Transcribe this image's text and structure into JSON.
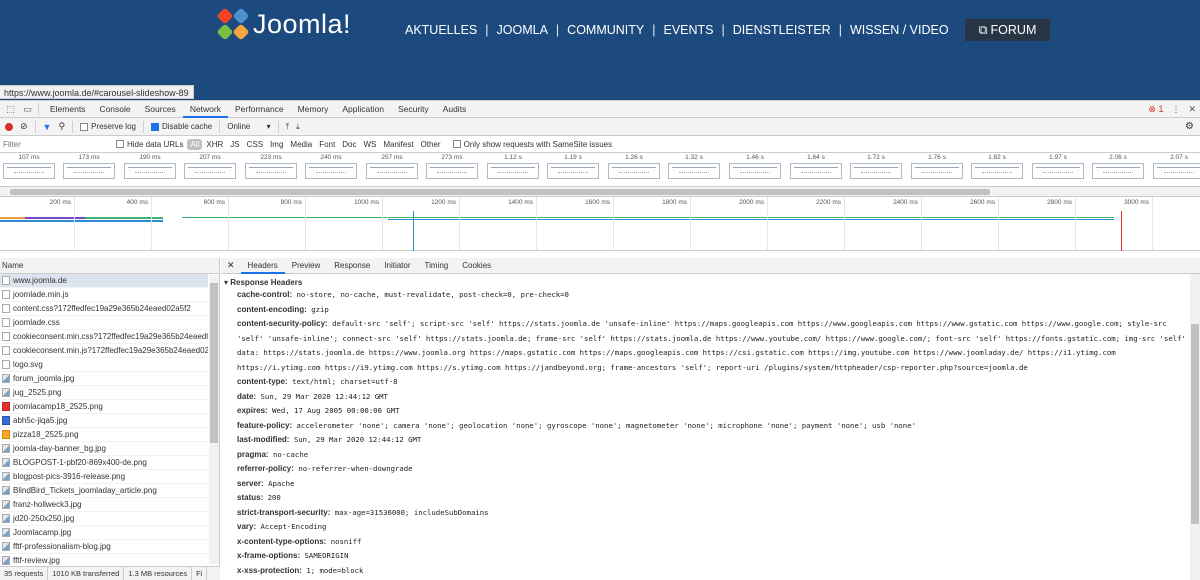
{
  "site": {
    "logo_text": "Joomla!",
    "nav": [
      "AKTUELLES",
      "JOOMLA",
      "COMMUNITY",
      "EVENTS",
      "DIENSTLEISTER",
      "WISSEN / VIDEO"
    ],
    "forum_label": "FORUM",
    "status_url": "https://www.joomla.de/#carousel-slideshow-89"
  },
  "devtools": {
    "tabs": [
      "Elements",
      "Console",
      "Sources",
      "Network",
      "Performance",
      "Memory",
      "Application",
      "Security",
      "Audits"
    ],
    "active_tab": "Network",
    "error_count": "1",
    "toolbar": {
      "preserve_log": "Preserve log",
      "disable_cache": "Disable cache",
      "throttle": "Online"
    },
    "filter": {
      "placeholder": "Filter",
      "hide_data_urls": "Hide data URLs",
      "types": [
        "All",
        "XHR",
        "JS",
        "CSS",
        "Img",
        "Media",
        "Font",
        "Doc",
        "WS",
        "Manifest",
        "Other"
      ],
      "samesite": "Only show requests with SameSite issues"
    },
    "frames": [
      "107 ms",
      "173 ms",
      "190 ms",
      "207 ms",
      "223 ms",
      "240 ms",
      "257 ms",
      "273 ms",
      "1.12 s",
      "1.19 s",
      "1.26 s",
      "1.32 s",
      "1.46 s",
      "1.64 s",
      "1.72 s",
      "1.76 s",
      "1.82 s",
      "1.97 s",
      "2.06 s",
      "2.07 s"
    ],
    "timeline_ticks": [
      "200 ms",
      "400 ms",
      "600 ms",
      "800 ms",
      "1000 ms",
      "1200 ms",
      "1400 ms",
      "1600 ms",
      "1800 ms",
      "2000 ms",
      "2200 ms",
      "2400 ms",
      "2600 ms",
      "2800 ms",
      "3000 ms"
    ],
    "name_header": "Name",
    "files": [
      {
        "name": "www.joomla.de",
        "icon": "doc"
      },
      {
        "name": "joomlade.min.js",
        "icon": "doc"
      },
      {
        "name": "content.css?172ffedfec19a29e365b24eaed02a5f2",
        "icon": "doc"
      },
      {
        "name": "joomlade.css",
        "icon": "doc"
      },
      {
        "name": "cookieconsent.min.css?172ffedfec19a29e365b24eaed02a5f2",
        "icon": "doc"
      },
      {
        "name": "cookieconsent.min.js?172ffedfec19a29e365b24eaed02a5f2",
        "icon": "doc"
      },
      {
        "name": "logo.svg",
        "icon": "doc"
      },
      {
        "name": "forum_joomla.jpg",
        "icon": "img"
      },
      {
        "name": "jug_2525.png",
        "icon": "img"
      },
      {
        "name": "joomlacamp18_2525.png",
        "icon": "red"
      },
      {
        "name": "abh5c-jiqa5.jpg",
        "icon": "blue"
      },
      {
        "name": "pizza18_2525.png",
        "icon": "orange"
      },
      {
        "name": "joomla-day-banner_bg.jpg",
        "icon": "img"
      },
      {
        "name": "BLOGPOST-1-pbf20-869x400-de.png",
        "icon": "img"
      },
      {
        "name": "blogpost-pics-3916-release.png",
        "icon": "img"
      },
      {
        "name": "BlindBird_Tickets_joomladay_article.png",
        "icon": "img"
      },
      {
        "name": "franz-hollweck3.jpg",
        "icon": "img"
      },
      {
        "name": "jd20-250x250.jpg",
        "icon": "img"
      },
      {
        "name": "Joomlacamp.jpg",
        "icon": "img"
      },
      {
        "name": "fftf-professionalism-blog.jpg",
        "icon": "img"
      },
      {
        "name": "fftf-review.jpg",
        "icon": "img"
      }
    ],
    "summary": [
      "35 requests",
      "1010 KB transferred",
      "1.3 MB resources",
      "Fi"
    ],
    "detail_tabs": [
      "Headers",
      "Preview",
      "Response",
      "Initiator",
      "Timing",
      "Cookies"
    ],
    "section_title": "Response Headers",
    "headers": [
      {
        "k": "cache-control:",
        "v": "no-store, no-cache, must-revalidate, post-check=0, pre-check=0"
      },
      {
        "k": "content-encoding:",
        "v": "gzip"
      },
      {
        "k": "content-security-policy:",
        "v": "default-src 'self'; script-src 'self' https://stats.joomla.de 'unsafe-inline' https://maps.googleapis.com https://www.googleapis.com https://www.gstatic.com https://www.google.com; style-src 'self' 'unsafe-inline'; connect-src 'self' https://stats.joomla.de; frame-src 'self' https://stats.joomla.de https://www.youtube.com/ https://www.google.com/; font-src 'self' https://fonts.gstatic.com; img-src 'self' data: https://stats.joomla.de https://www.joomla.org https://maps.gstatic.com https://maps.googleapis.com https://csi.gstatic.com https://img.youtube.com https://www.joomladay.de/ https://i1.ytimg.com https://i.ytimg.com https://i9.ytimg.com https://s.ytimg.com https://jandbeyond.org; frame-ancestors 'self'; report-uri /plugins/system/httpheader/csp-reporter.php?source=joomla.de"
      },
      {
        "k": "content-type:",
        "v": "text/html; charset=utf-8"
      },
      {
        "k": "date:",
        "v": "Sun, 29 Mar 2020 12:44:12 GMT"
      },
      {
        "k": "expires:",
        "v": "Wed, 17 Aug 2005 00:00:00 GMT"
      },
      {
        "k": "feature-policy:",
        "v": "accelerometer 'none'; camera 'none'; geolocation 'none'; gyroscope 'none'; magnetometer 'none'; microphone 'none'; payment 'none'; usb 'none'"
      },
      {
        "k": "last-modified:",
        "v": "Sun, 29 Mar 2020 12:44:12 GMT"
      },
      {
        "k": "pragma:",
        "v": "no-cache"
      },
      {
        "k": "referrer-policy:",
        "v": "no-referrer-when-downgrade"
      },
      {
        "k": "server:",
        "v": "Apache"
      },
      {
        "k": "status:",
        "v": "200"
      },
      {
        "k": "strict-transport-security:",
        "v": "max-age=31536000; includeSubDomains"
      },
      {
        "k": "vary:",
        "v": "Accept-Encoding"
      },
      {
        "k": "x-content-type-options:",
        "v": "nosniff"
      },
      {
        "k": "x-frame-options:",
        "v": "SAMEORIGIN"
      },
      {
        "k": "x-xss-protection:",
        "v": "1; mode=block"
      }
    ],
    "colors": {
      "accent": "#1a73e8",
      "site_bg": "#1d4a7e",
      "forum_btn": "#273545",
      "record": "#d93025"
    }
  }
}
